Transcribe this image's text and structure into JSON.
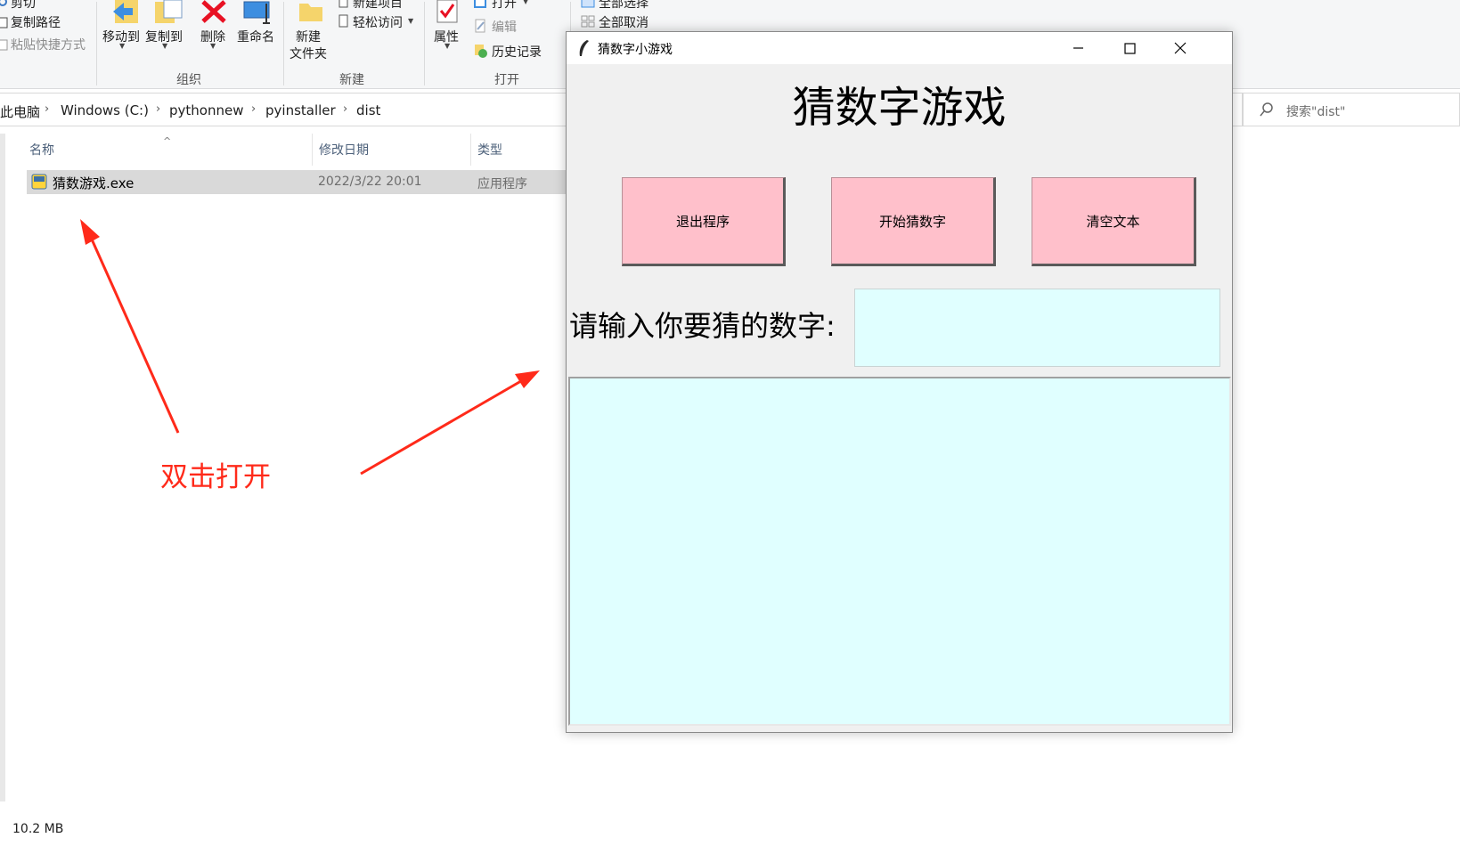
{
  "ribbon": {
    "cut_label": "剪切",
    "copy_path_label": "复制路径",
    "paste_shortcut_label": "粘贴快捷方式",
    "move_to_label": "移动到",
    "copy_to_label": "复制到",
    "delete_label": "删除",
    "rename_label": "重命名",
    "organize_group": "组织",
    "new_folder_label_line1": "新建",
    "new_folder_label_line2": "文件夹",
    "new_item_label": "新建项目",
    "easy_access_label": "轻松访问",
    "new_group": "新建",
    "properties_label": "属性",
    "open_label": "打开",
    "edit_label": "编辑",
    "history_label": "历史记录",
    "open_group": "打开",
    "select_all_label": "全部选择",
    "select_none_label": "全部取消"
  },
  "addressbar": {
    "crumbs": [
      "此电脑",
      "Windows (C:)",
      "pythonnew",
      "pyinstaller",
      "dist"
    ],
    "search_placeholder": "搜索\"dist\""
  },
  "filelist": {
    "columns": [
      "名称",
      "修改日期",
      "类型"
    ],
    "rows": [
      {
        "name": "猜数游戏.exe",
        "date": "2022/3/22 20:01",
        "type": "应用程序"
      }
    ]
  },
  "status": {
    "size": "10.2 MB"
  },
  "annotation": {
    "text": "双击打开",
    "color": "#ff2a1a"
  },
  "tkwindow": {
    "title": "猜数字小游戏",
    "heading": "猜数字游戏",
    "buttons": [
      "退出程序",
      "开始猜数字",
      "清空文本"
    ],
    "prompt": "请输入你要猜的数字:",
    "entry_value": "",
    "button_color": "#ffc0cb",
    "field_color": "#e0ffff"
  }
}
